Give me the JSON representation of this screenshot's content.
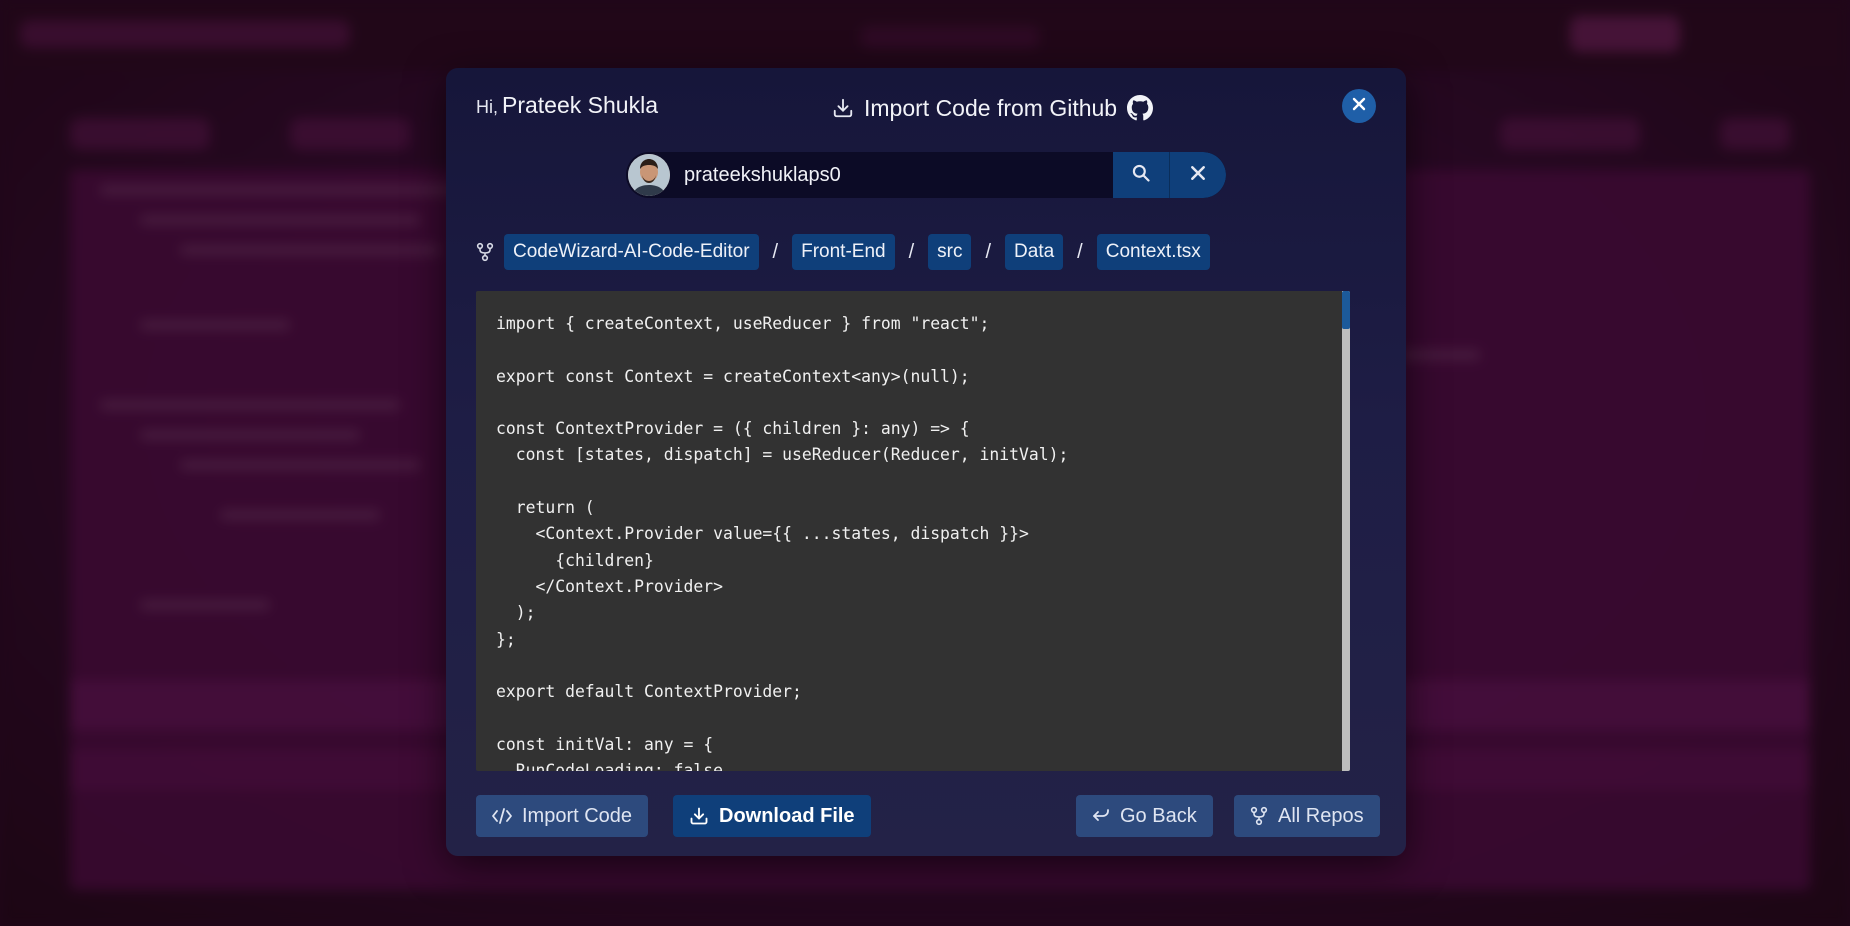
{
  "modal": {
    "greeting_prefix": "Hi,",
    "user_name": "Prateek Shukla",
    "title": "Import Code from Github",
    "close_icon": "close-icon"
  },
  "search": {
    "value": "prateekshuklaps0"
  },
  "breadcrumb": {
    "items": [
      "CodeWizard-AI-Code-Editor",
      "Front-End",
      "src",
      "Data",
      "Context.tsx"
    ],
    "separator": "/"
  },
  "code": {
    "lines": [
      "import { createContext, useReducer } from \"react\";",
      "",
      "export const Context = createContext<any>(null);",
      "",
      "const ContextProvider = ({ children }: any) => {",
      "  const [states, dispatch] = useReducer(Reducer, initVal);",
      "",
      "  return (",
      "    <Context.Provider value={{ ...states, dispatch }}>",
      "      {children}",
      "    </Context.Provider>",
      "  );",
      "};",
      "",
      "export default ContextProvider;",
      "",
      "const initVal: any = {",
      "  RunCodeLoading: false,"
    ]
  },
  "footer": {
    "import_code": "Import Code",
    "download_file": "Download File",
    "go_back": "Go Back",
    "all_repos": "All Repos"
  },
  "colors": {
    "accent": "#0f3f7a",
    "modal_bg": "#1e1d45",
    "code_bg": "#323232"
  }
}
